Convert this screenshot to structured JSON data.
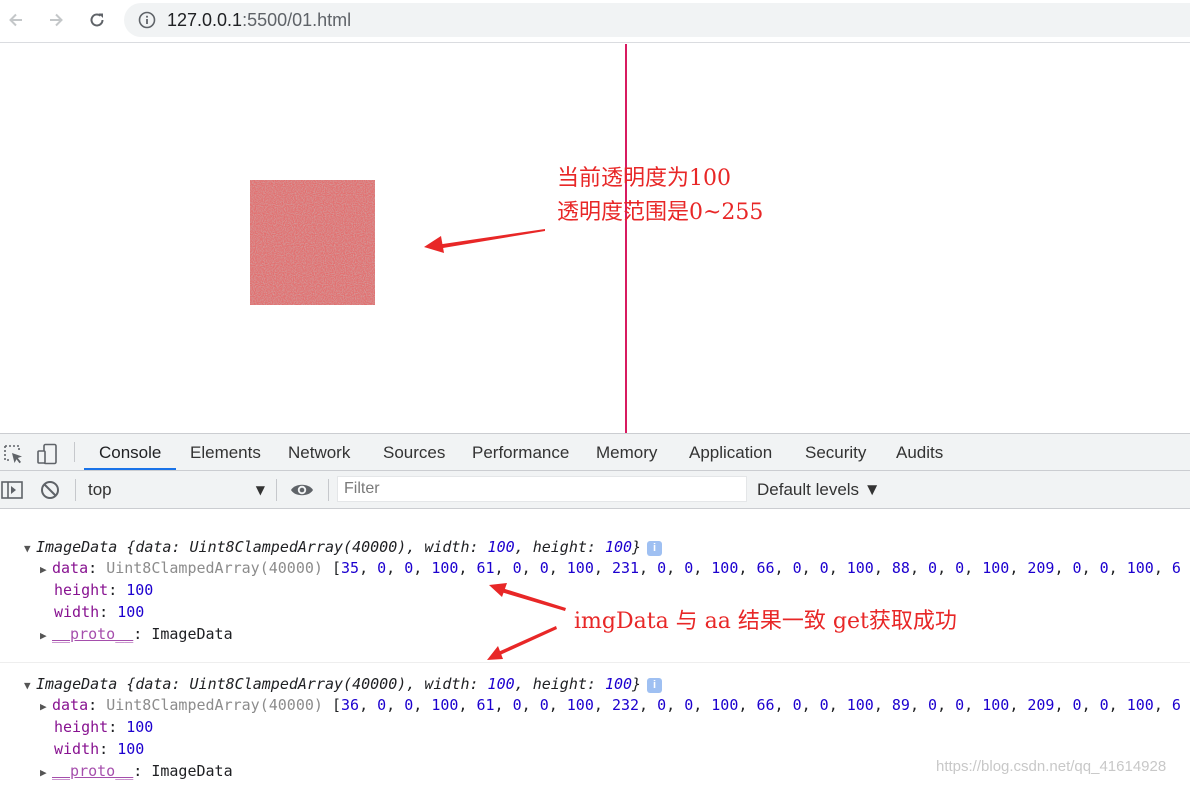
{
  "browser": {
    "url_host": "127.0.0.1",
    "url_rest": ":5500/01.html"
  },
  "page": {
    "note_line1": "当前透明度为100",
    "note_line2": "透明度范围是0~255",
    "canvas_color": "#e36f6f"
  },
  "devtools": {
    "tabs": [
      "Console",
      "Elements",
      "Network",
      "Sources",
      "Performance",
      "Memory",
      "Application",
      "Security",
      "Audits"
    ],
    "active_tab": "Console",
    "context": "top",
    "filter_placeholder": "Filter",
    "levels": "Default levels ▼",
    "entries": [
      {
        "type_name": "ImageData",
        "summary_open": "{data: Uint8ClampedArray(40000), width: ",
        "width": "100",
        "summary_mid": ", height: ",
        "height": "100",
        "summary_close": "}",
        "data_label": "data",
        "data_type": "Uint8ClampedArray(40000)",
        "data_values": [
          "35",
          "0",
          "0",
          "100",
          "61",
          "0",
          "0",
          "100",
          "231",
          "0",
          "0",
          "100",
          "66",
          "0",
          "0",
          "100",
          "88",
          "0",
          "0",
          "100",
          "209",
          "0",
          "0",
          "100",
          "6"
        ],
        "height_label": "height",
        "width_label": "width",
        "proto_label": "__proto__",
        "proto_value": "ImageData"
      },
      {
        "type_name": "ImageData",
        "summary_open": "{data: Uint8ClampedArray(40000), width: ",
        "width": "100",
        "summary_mid": ", height: ",
        "height": "100",
        "summary_close": "}",
        "data_label": "data",
        "data_type": "Uint8ClampedArray(40000)",
        "data_values": [
          "36",
          "0",
          "0",
          "100",
          "61",
          "0",
          "0",
          "100",
          "232",
          "0",
          "0",
          "100",
          "66",
          "0",
          "0",
          "100",
          "89",
          "0",
          "0",
          "100",
          "209",
          "0",
          "0",
          "100",
          "6"
        ],
        "height_label": "height",
        "width_label": "width",
        "proto_label": "__proto__",
        "proto_value": "ImageData"
      }
    ]
  },
  "annotation": {
    "text": "imgData 与 aa 结果一致 get获取成功",
    "color": "#e82727"
  },
  "watermark": "https://blog.csdn.net/qq_41614928"
}
